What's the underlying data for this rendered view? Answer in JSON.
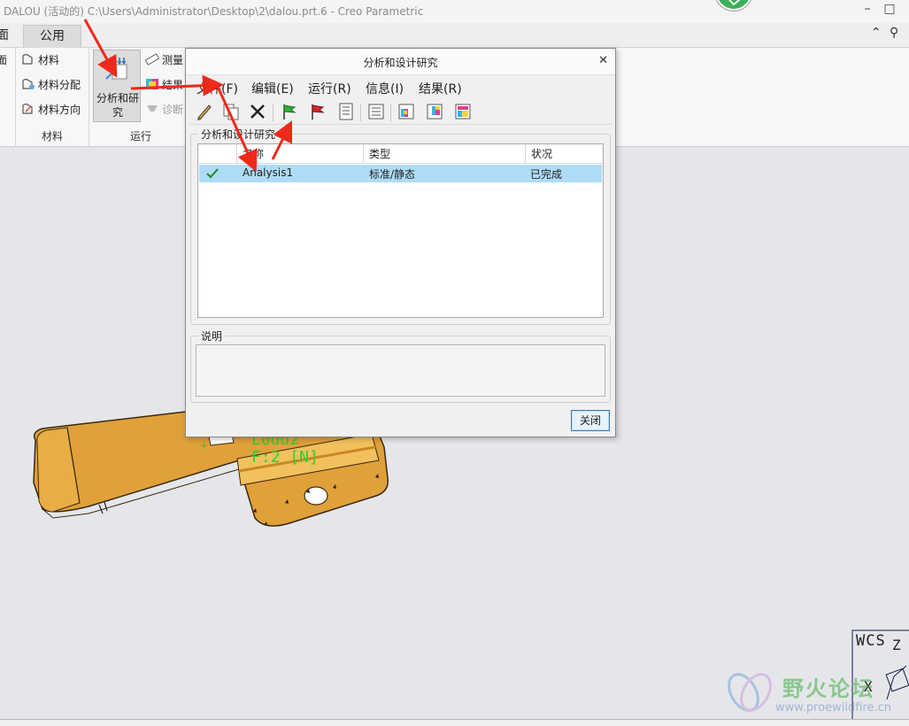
{
  "window": {
    "title": "DALOU (活动的) C:\\Users\\Administrator\\Desktop\\2\\dalou.prt.6 - Creo Parametric"
  },
  "tabs": [
    {
      "label": "面"
    },
    {
      "label": "公用"
    }
  ],
  "ribbon": {
    "material_group": {
      "items": [
        {
          "label": "材料",
          "icon": "material-icon"
        },
        {
          "label": "材料分配",
          "icon": "material-assign-icon"
        },
        {
          "label": "材料方向",
          "icon": "material-orientation-icon"
        }
      ],
      "label": "材料"
    },
    "run_group": {
      "big_button": {
        "label_line1": "分析和研",
        "label_line2": "究",
        "icon": "analysis-study-icon"
      },
      "items": [
        {
          "label": "测量",
          "icon": "measure-icon"
        },
        {
          "label": "结果",
          "icon": "results-icon"
        },
        {
          "label": "诊断",
          "icon": "diagnostics-icon",
          "enabled": false
        }
      ],
      "label": "运行"
    }
  },
  "dialog": {
    "title": "分析和设计研究",
    "menu": [
      "文件(F)",
      "编辑(E)",
      "运行(R)",
      "信息(I)",
      "结果(R)"
    ],
    "toolbar_icons": [
      "edit-pencil-icon",
      "copy-icon",
      "delete-x-icon",
      "start-green-flag-icon",
      "stop-red-flag-icon",
      "status-list-icon",
      "summary-icon",
      "results-icon",
      "results-view-icon",
      "results-window-icon"
    ],
    "studies_group_label": "分析和设计研究",
    "columns": [
      "名称",
      "类型",
      "状况"
    ],
    "rows": [
      {
        "status_icon": "check-icon",
        "name": "Analysis1",
        "type": "标准/静态",
        "state": "已完成"
      }
    ],
    "description_label": "说明",
    "description_value": "",
    "close_label": "关闭"
  },
  "viewport": {
    "model_text_1": "L0dd2",
    "model_text_2": "F:2 [N]",
    "csys_label": "WCS",
    "axis_x_label": "X",
    "axis_z_label": "Z"
  },
  "watermark": {
    "text": "野火论坛",
    "url": "www.proewildfire.cn"
  },
  "colors": {
    "part_fill": "#e0a03a",
    "selection": "#aedcf7",
    "annotation_arrow": "#ee2a1a",
    "model_text": "#33cc33"
  }
}
